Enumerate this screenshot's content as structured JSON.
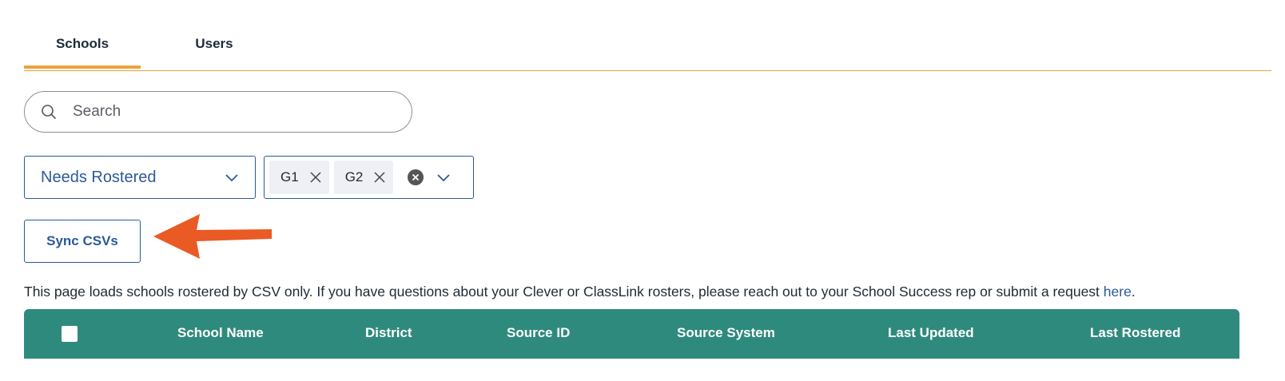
{
  "tabs": [
    {
      "label": "Schools",
      "active": true
    },
    {
      "label": "Users",
      "active": false
    }
  ],
  "search": {
    "placeholder": "Search",
    "value": "",
    "icon": "search-icon"
  },
  "filters": {
    "status_select": {
      "value": "Needs Rostered",
      "icon": "chevron-down-icon"
    },
    "grade_select": {
      "chips": [
        "G1",
        "G2"
      ],
      "chip_remove_icon": "close-icon",
      "clear_icon": "close-circle-icon",
      "icon": "chevron-down-icon"
    }
  },
  "sync_button": {
    "label": "Sync CSVs"
  },
  "annotation": {
    "icon": "arrow-left-icon",
    "color": "#ea5a24"
  },
  "info": {
    "text": "This page loads schools rostered by CSV only. If you have questions about your Clever or ClassLink rosters, please reach out to your School Success rep or submit a request ",
    "link": "here",
    "suffix": "."
  },
  "table": {
    "header_color": "#2f8a7e",
    "columns": [
      "School Name",
      "District",
      "Source ID",
      "Source System",
      "Last Updated",
      "Last Rostered"
    ]
  },
  "colors": {
    "accent": "#f0a23a",
    "primary": "#2c5a9a"
  }
}
